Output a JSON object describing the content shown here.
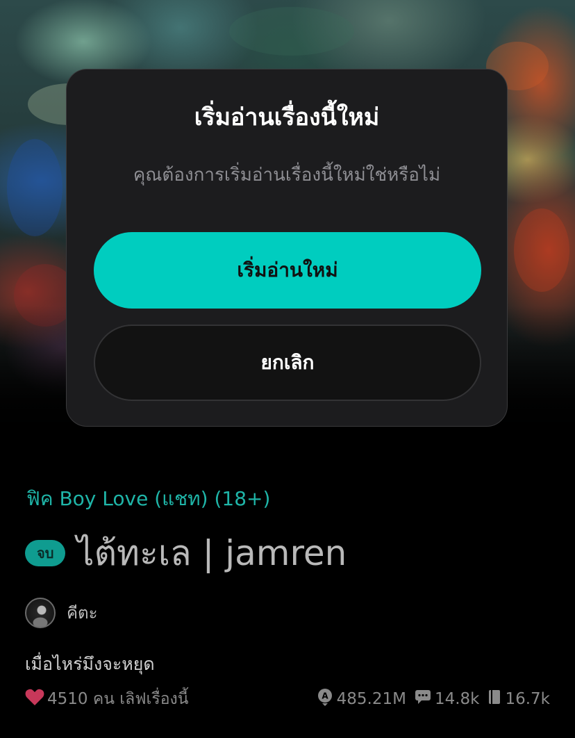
{
  "dialog": {
    "title": "เริ่มอ่านเรื่องนี้ใหม่",
    "message": "คุณต้องการเริ่มอ่านเรื่องนี้ใหม่ใช่หรือไม่",
    "confirm_label": "เริ่มอ่านใหม่",
    "cancel_label": "ยกเลิก"
  },
  "story": {
    "category": "ฟิค Boy Love (แชท) (18+)",
    "status_badge": "จบ",
    "title": "ไต้ทะเล | jamren",
    "author": "คีตะ",
    "tagline": "เมื่อไหร่มึงจะหยุด",
    "likes_text": "4510 คน เลิฟเรื่องนี้",
    "views": "485.21M",
    "comments": "14.8k",
    "chapters": "16.7k"
  },
  "colors": {
    "accent": "#00cdbf",
    "category": "#1fb5a8",
    "heart": "#c8385a"
  },
  "icons": [
    "heart-icon",
    "views-icon",
    "comments-icon",
    "chapters-icon",
    "avatar"
  ]
}
